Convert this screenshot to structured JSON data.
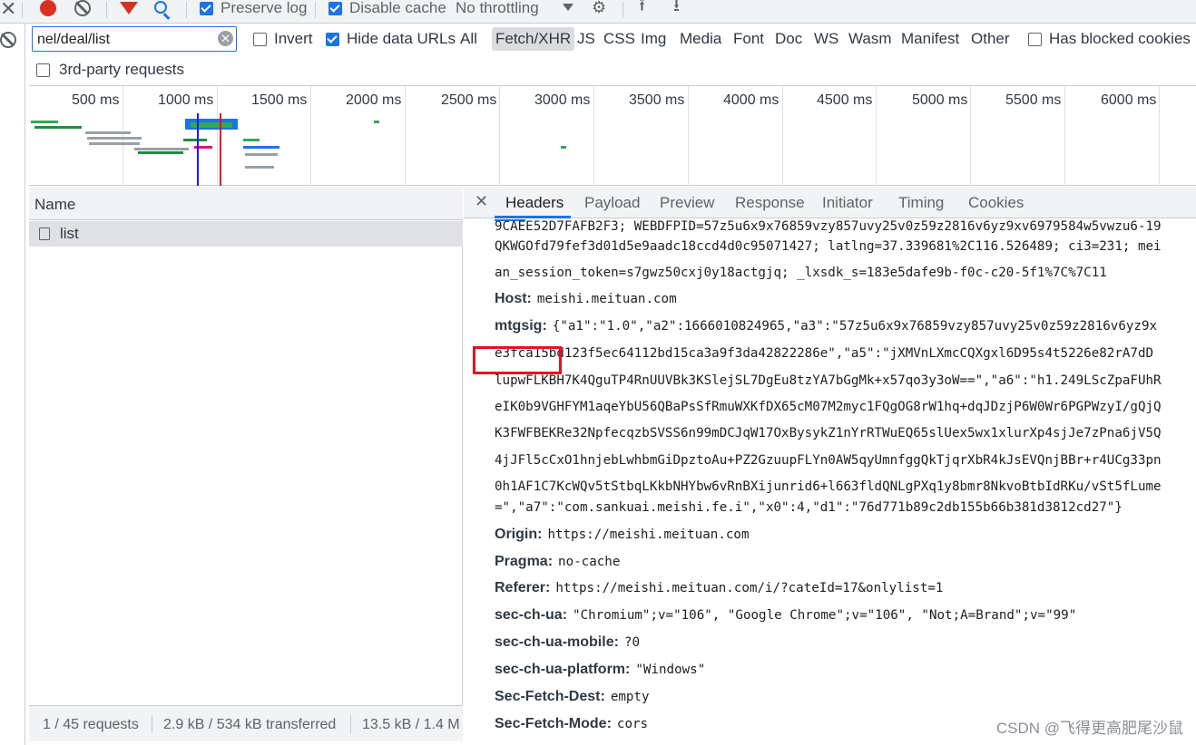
{
  "toolbar": {
    "preserve_log": "Preserve log",
    "disable_cache": "Disable cache",
    "throttling": "No throttling"
  },
  "filter": {
    "value": "nel/deal/list",
    "invert": "Invert",
    "hide_data_urls": "Hide data URLs",
    "types": [
      "All",
      "Fetch/XHR",
      "JS",
      "CSS",
      "Img",
      "Media",
      "Font",
      "Doc",
      "WS",
      "Wasm",
      "Manifest",
      "Other"
    ],
    "active_type": "Fetch/XHR",
    "has_blocked_cookies": "Has blocked cookies",
    "third_party": "3rd-party requests"
  },
  "overview": {
    "ticks": [
      "500 ms",
      "1000 ms",
      "1500 ms",
      "2000 ms",
      "2500 ms",
      "3000 ms",
      "3500 ms",
      "4000 ms",
      "4500 ms",
      "5000 ms",
      "5500 ms",
      "6000 ms"
    ]
  },
  "list": {
    "column_name": "Name",
    "rows": [
      "list"
    ],
    "status": {
      "requests": "1 / 45 requests",
      "transferred": "2.9 kB / 534 kB transferred",
      "resources": "13.5 kB / 1.4 M"
    }
  },
  "detail": {
    "tabs": [
      "Headers",
      "Payload",
      "Preview",
      "Response",
      "Initiator",
      "Timing",
      "Cookies"
    ],
    "active_tab": "Headers",
    "cookie_lines": [
      "9CAEE52D7FAFB2F3; WEBDFPID=57z5u6x9x76859vzy857uvy25v0z59z2816v6yz9xv6979584w5vwzu6-19",
      "QKWGOfd79fef3d01d5e9aadc18ccd4d0c95071427; latlng=37.339681%2C116.526489; ci3=231; mei",
      "an_session_token=s7gwz50cxj0y18actgjq; _lxsdk_s=183e5dafe9b-f0c-c20-5f1%7C%7C11"
    ],
    "host": {
      "key": "Host:",
      "value": "meishi.meituan.com"
    },
    "mtgsig": {
      "key": "mtgsig:",
      "lines": [
        "{\"a1\":\"1.0\",\"a2\":1666010824965,\"a3\":\"57z5u6x9x76859vzy857uvy25v0z59z2816v6yz9x",
        "e3fca15bd123f5ec64112bd15ca3a9f3da42822286e\",\"a5\":\"jXMVnLXmcCQXgxl6D95s4t5226e82rA7dD",
        "lupwFLKBH7K4QguTP4RnUUVBk3KSlejSL7DgEu8tzYA7bGgMk+x57qo3y3oW==\",\"a6\":\"h1.249LScZpaFUhR",
        "eIK0b9VGHFYM1aqeYbU56QBaPsSfRmuWXKfDX65cM07M2myc1FQgOG8rW1hq+dqJDzjP6W0Wr6PGPWzyI/gQjQ",
        "K3FWFBEKRe32NpfecqzbSVSS6n99mDCJqW17OxBysykZ1nYrRTWuEQ65slUex5wx1xlurXp4sjJe7zPna6jV5Q",
        "4jJFl5cCxO1hnjebLwhbmGiDpztoAu+PZ2GzuupFLYn0AW5qyUmnfggQkTjqrXbR4kJsEVQnjBBr+r4UCg33pn",
        "0h1AF1C7KcWQv5tStbqLKkbNHYbw6vRnBXijunrid6+l663fldQNLgPXq1y8bmr8NkvoBtbIdRKu/vSt5fLume",
        "=\",\"a7\":\"com.sankuai.meishi.fe.i\",\"x0\":4,\"d1\":\"76d771b89c2db155b66b381d3812cd27\"}"
      ]
    },
    "headers": [
      {
        "key": "Origin:",
        "value": "https://meishi.meituan.com"
      },
      {
        "key": "Pragma:",
        "value": "no-cache"
      },
      {
        "key": "Referer:",
        "value": "https://meishi.meituan.com/i/?cateId=17&onlylist=1"
      },
      {
        "key": "sec-ch-ua:",
        "value": "\"Chromium\";v=\"106\", \"Google Chrome\";v=\"106\", \"Not;A=Brand\";v=\"99\""
      },
      {
        "key": "sec-ch-ua-mobile:",
        "value": "?0"
      },
      {
        "key": "sec-ch-ua-platform:",
        "value": "\"Windows\""
      },
      {
        "key": "Sec-Fetch-Dest:",
        "value": "empty"
      },
      {
        "key": "Sec-Fetch-Mode:",
        "value": "cors"
      }
    ]
  },
  "watermark": "CSDN @飞得更高肥尾沙鼠",
  "colors": {
    "accent": "#1a73e8",
    "record": "#d93025",
    "highlight_box": "#e8101f"
  }
}
